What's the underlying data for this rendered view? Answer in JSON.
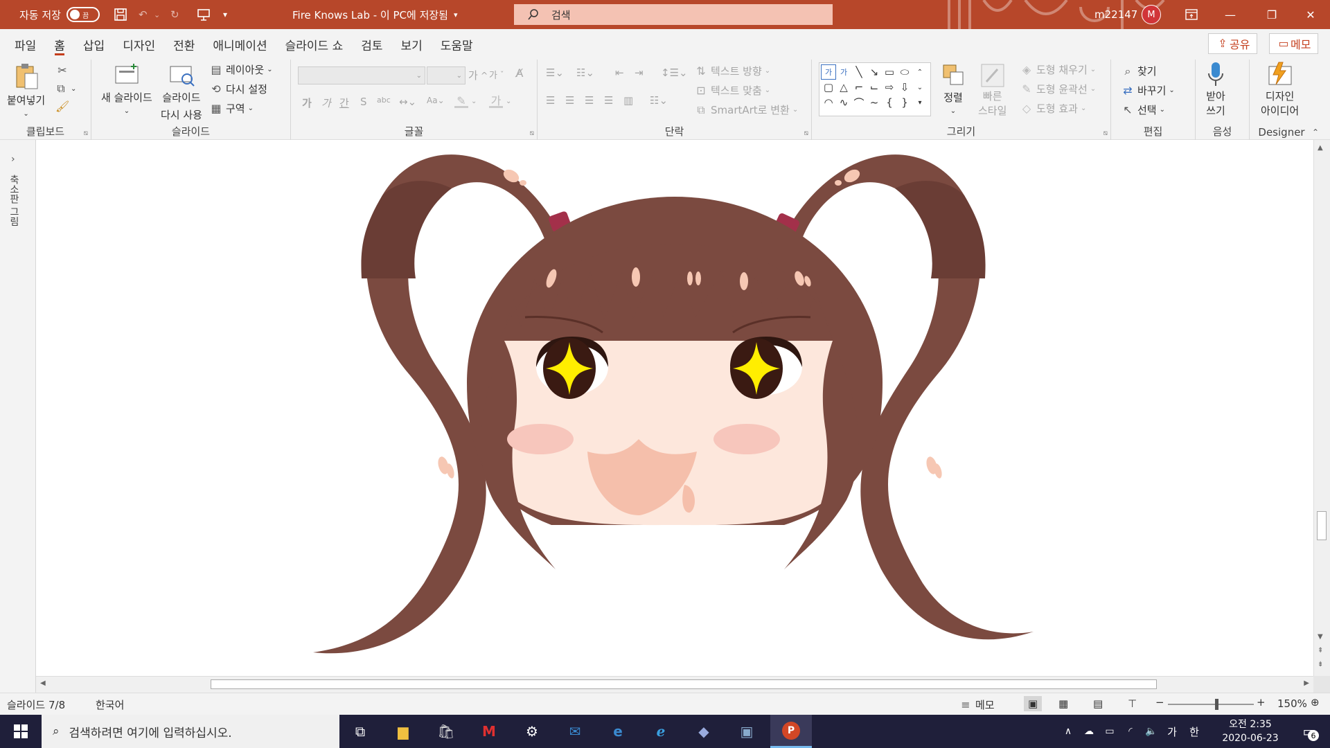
{
  "titlebar": {
    "autosave_label": "자동 저장",
    "autosave_state": "끔",
    "doc_title": "Fire Knows Lab - 이 PC에 저장됨",
    "search_placeholder": "검색",
    "username": "m22147",
    "avatar_initial": "M"
  },
  "tabs": [
    "파일",
    "홈",
    "삽입",
    "디자인",
    "전환",
    "애니메이션",
    "슬라이드 쇼",
    "검토",
    "보기",
    "도움말"
  ],
  "tab_actions": {
    "share": "공유",
    "memo": "메모"
  },
  "ribbon": {
    "clipboard": {
      "paste": "붙여넣기",
      "label": "클립보드"
    },
    "slides": {
      "new_slide": "새 슬라이드",
      "reuse_line1": "슬라이드",
      "reuse_line2": "다시 사용",
      "layout": "레이아웃",
      "reset": "다시 설정",
      "section": "구역",
      "label": "슬라이드"
    },
    "font": {
      "label": "글꼴",
      "bold": "가",
      "italic": "가",
      "underline": "간",
      "strike": "S",
      "grow": "가",
      "shrink": "가"
    },
    "paragraph": {
      "label": "단락",
      "text_dir": "텍스트 방향",
      "align_text": "텍스트 맞춤",
      "smartart": "SmartArt로 변환"
    },
    "drawing": {
      "label": "그리기",
      "arrange": "정렬",
      "quick_line1": "빠른",
      "quick_line2": "스타일",
      "fill": "도형 채우기",
      "outline": "도형 윤곽선",
      "effect": "도형 효과"
    },
    "editing": {
      "label": "편집",
      "find": "찾기",
      "replace": "바꾸기",
      "select": "선택"
    },
    "voice": {
      "label": "음성",
      "dictate_line1": "받아",
      "dictate_line2": "쓰기"
    },
    "designer": {
      "label": "Designer",
      "ideas_line1": "디자인",
      "ideas_line2": "아이디어"
    }
  },
  "left_panel": {
    "label": "축소판 그림"
  },
  "status": {
    "slide": "슬라이드 7/8",
    "language": "한국어",
    "notes": "메모",
    "zoom": "150%"
  },
  "taskbar": {
    "search_placeholder": "검색하려면 여기에 입력하십시오.",
    "time": "오전 2:35",
    "date": "2020-06-23",
    "ime_mode": "가",
    "ime_lang": "한",
    "notif_count": "6"
  },
  "colors": {
    "accent": "#b7472a",
    "hair": "#7b4a40",
    "hair_dark": "#6a3d35",
    "skin": "#fde7dc",
    "tie": "#a3304a",
    "eye_star": "#ffee00"
  }
}
